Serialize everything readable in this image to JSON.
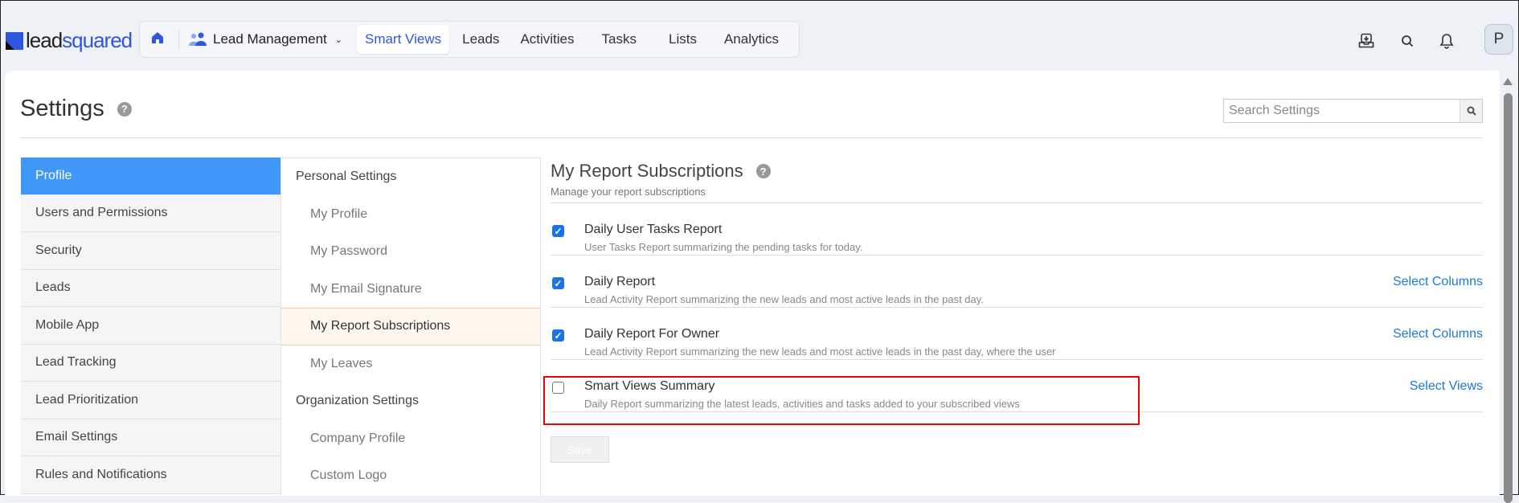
{
  "brand": {
    "logo_part1": "lead",
    "logo_part2": "squared"
  },
  "nav": {
    "workspace": "Lead Management",
    "items": [
      "Smart Views",
      "Leads",
      "Activities",
      "Tasks",
      "Lists",
      "Analytics"
    ],
    "active": "Smart Views"
  },
  "user": {
    "avatar_initial": "P"
  },
  "page": {
    "title": "Settings",
    "search_placeholder": "Search Settings"
  },
  "left_nav": [
    "Profile",
    "Users and Permissions",
    "Security",
    "Leads",
    "Mobile App",
    "Lead Tracking",
    "Lead Prioritization",
    "Email Settings",
    "Rules and Notifications"
  ],
  "mid_nav": {
    "personal_header": "Personal Settings",
    "personal_items": [
      "My Profile",
      "My Password",
      "My Email Signature",
      "My Report Subscriptions",
      "My Leaves"
    ],
    "org_header": "Organization Settings",
    "org_items": [
      "Company Profile",
      "Custom Logo"
    ]
  },
  "content": {
    "title": "My Report Subscriptions",
    "subtitle": "Manage your report subscriptions",
    "subscriptions": [
      {
        "title": "Daily User Tasks Report",
        "desc": "User Tasks Report summarizing the pending tasks for today.",
        "checked": true,
        "link": ""
      },
      {
        "title": "Daily Report",
        "desc": "Lead Activity Report summarizing the new leads and most active leads in the past day.",
        "checked": true,
        "link": "Select Columns"
      },
      {
        "title": "Daily Report For Owner",
        "desc": "Lead Activity Report summarizing the new leads and most active leads in the past day, where the user",
        "checked": true,
        "link": "Select Columns"
      },
      {
        "title": "Smart Views Summary",
        "desc": "Daily Report summarizing the latest leads, activities and tasks added to your subscribed views",
        "checked": false,
        "link": "Select Views"
      }
    ],
    "save_label": "Save"
  },
  "colors": {
    "accent": "#2f56e0",
    "active_nav": "#3f97f7",
    "highlight": "#e00000",
    "link": "#1a7ad6"
  }
}
